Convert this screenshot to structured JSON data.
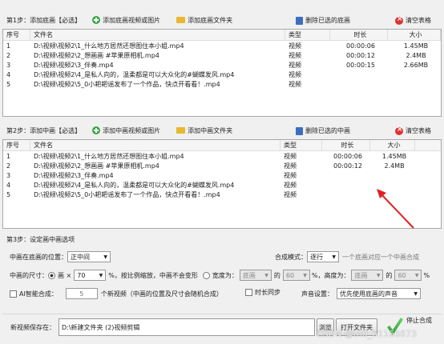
{
  "step1": {
    "label": "第1步：添加底画【必选】",
    "add_btn": "添加底画视频或图片",
    "folder_btn": "添加底画文件夹",
    "delete_btn": "删除已选的底画",
    "clear_btn": "清空表格",
    "headers": [
      "序号",
      "文件名",
      "类型",
      "时长",
      "大小"
    ],
    "rows": [
      {
        "no": "1",
        "name": "D:\\视频\\视频2\\1_什么地方居然还想图住本小姐.mp4",
        "type": "视频",
        "dur": "00:00:06",
        "size": "1.45MB"
      },
      {
        "no": "2",
        "name": "D:\\视频\\视频2\\2_想画画 #苹果原相机.mp4",
        "type": "视频",
        "dur": "00:00:12",
        "size": "2.4MB"
      },
      {
        "no": "3",
        "name": "D:\\视频\\视频2\\3_伴奏.mp4",
        "type": "视频",
        "dur": "00:00:15",
        "size": "2.66MB"
      },
      {
        "no": "4",
        "name": "D:\\视频\\视频2\\4_是私人向的，温柔都是可以大众化的#蝴蝶发风.mp4",
        "type": "视频",
        "dur": "",
        "size": ""
      },
      {
        "no": "5",
        "name": "D:\\视频\\视频2\\5_0小耙耙谣发布了一个作品，快点开看看！.mp4",
        "type": "视频",
        "dur": "",
        "size": ""
      }
    ]
  },
  "step2": {
    "label": "第2步：添加中画【必选】",
    "add_btn": "添加中画视频或图片",
    "folder_btn": "添加中画文件夹",
    "delete_btn": "删除已选的中画",
    "clear_btn": "清空表格",
    "headers": [
      "序号",
      "文件名",
      "类型",
      "时长",
      "大小"
    ],
    "rows": [
      {
        "no": "1",
        "name": "D:\\视频\\视频2\\1_什么地方居然还想图住本小姐.mp4",
        "type": "视频",
        "dur": "00:00:06",
        "size": "1.45MB"
      },
      {
        "no": "2",
        "name": "D:\\视频\\视频2\\2_想画画 #苹果原相机.mp4",
        "type": "视频",
        "dur": "00:00:12",
        "size": "2.4MB"
      },
      {
        "no": "3",
        "name": "D:\\视频\\视频2\\3_伴奏.mp4",
        "type": "视频",
        "dur": "",
        "size": ""
      },
      {
        "no": "4",
        "name": "D:\\视频\\视频2\\4_是私人向的，温柔都是可以大众化的#蝴蝶发风.mp4",
        "type": "视频",
        "dur": "",
        "size": ""
      },
      {
        "no": "5",
        "name": "D:\\视频\\视频2\\5_0小耙耙谣发布了一个作品，快点开看看！.mp4",
        "type": "视频",
        "dur": "",
        "size": ""
      }
    ]
  },
  "step3": {
    "label": "第3步：设定画中画选项",
    "pos_label": "中画在底画的位置：",
    "pos_value": "正中间",
    "mode_label": "合成模式：",
    "mode_value": "逐行",
    "mode_hint": "一个底画对应一个中画合成",
    "size_label": "中画的尺寸：",
    "size_mode": "画 ×",
    "size_value": "70",
    "size_unit": "%，按比例缩放，中画不会变形",
    "width_label": "宽度为：",
    "width_ref": "底画",
    "width_of": "的",
    "width_value": "60",
    "width_unit": "%，高度为：",
    "height_ref": "底画",
    "height_of": "的",
    "height_value": "60",
    "height_unit": "%",
    "ai_label": "AI智能合成：",
    "ai_value": "5",
    "ai_hint": "个新视频（中画的位置及尺寸会随机合成）",
    "sync_label": "时长同步",
    "sound_label": "声音设置：",
    "sound_value": "优先使用底画的声音"
  },
  "save": {
    "label": "新视频保存在：",
    "path": "D:\\新建文件夹 (2)视频剪辑",
    "browse": "浏览",
    "open": "打开文件夹",
    "stop": "停止合成",
    "start_label": "开始合成"
  },
  "watermark": "CSDN @m0_61166673"
}
